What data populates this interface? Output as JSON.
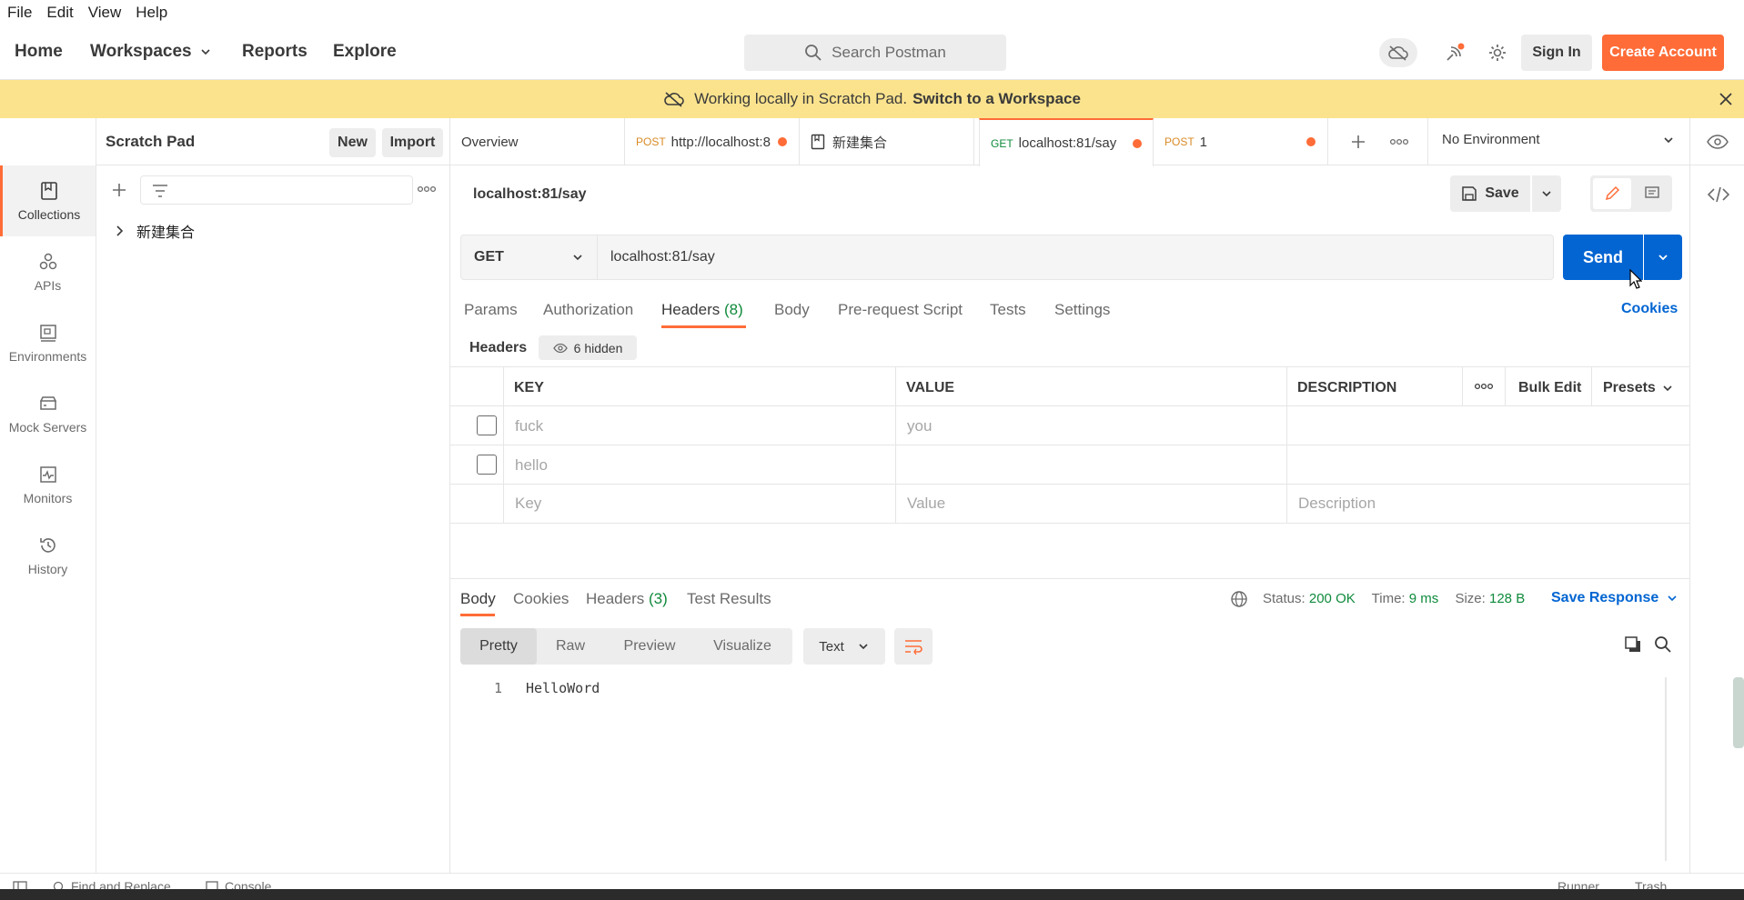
{
  "menu": [
    "File",
    "Edit",
    "View",
    "Help"
  ],
  "header": {
    "nav": {
      "home": "Home",
      "workspaces": "Workspaces",
      "reports": "Reports",
      "explore": "Explore"
    },
    "search_placeholder": "Search Postman",
    "sign_in": "Sign In",
    "create_account": "Create Account"
  },
  "banner": {
    "text": "Working locally in Scratch Pad.",
    "link": "Switch to a Workspace"
  },
  "rail": [
    "Collections",
    "APIs",
    "Environments",
    "Mock Servers",
    "Monitors",
    "History"
  ],
  "sidebar": {
    "title": "Scratch Pad",
    "new": "New",
    "import": "Import",
    "tree_item": "新建集合"
  },
  "tabs": {
    "overview": "Overview",
    "t1_method": "POST",
    "t1_label": "http://localhost:8",
    "t2_label": "新建集合",
    "t3_method": "GET",
    "t3_label": "localhost:81/say",
    "t4_method": "POST",
    "t4_label": "1",
    "environment": "No Environment"
  },
  "request": {
    "title": "localhost:81/say",
    "save": "Save",
    "method": "GET",
    "url": "localhost:81/say",
    "send": "Send",
    "cookies": "Cookies",
    "subtabs": {
      "params": "Params",
      "authorization": "Authorization",
      "headers": "Headers",
      "headers_count": "(8)",
      "body": "Body",
      "prerequest": "Pre-request Script",
      "tests": "Tests",
      "settings": "Settings"
    },
    "headers_label": "Headers",
    "hidden": "6 hidden",
    "table_headers": {
      "key": "KEY",
      "value": "VALUE",
      "description": "DESCRIPTION",
      "bulk_edit": "Bulk Edit",
      "presets": "Presets"
    },
    "rows": [
      {
        "key": "fuck",
        "value": "you"
      },
      {
        "key": "hello",
        "value": ""
      }
    ],
    "placeholders": {
      "key": "Key",
      "value": "Value",
      "description": "Description"
    }
  },
  "response": {
    "tabs": {
      "body": "Body",
      "cookies": "Cookies",
      "headers": "Headers",
      "headers_count": "(3)",
      "tests": "Test Results"
    },
    "status_label": "Status:",
    "status_value": "200 OK",
    "time_label": "Time:",
    "time_value": "9 ms",
    "size_label": "Size:",
    "size_value": "128 B",
    "save_response": "Save Response",
    "view_modes": [
      "Pretty",
      "Raw",
      "Preview",
      "Visualize"
    ],
    "format": "Text",
    "line_no": "1",
    "body_text": "HelloWord"
  },
  "status_bar": {
    "find_replace": "Find and Replace",
    "console": "Console",
    "runner": "Runner",
    "trash": "Trash"
  },
  "colors": {
    "accent": "#ff6c37",
    "send": "#0265d2",
    "banner": "#fbe38e",
    "status_ok": "#0f8a3c"
  }
}
